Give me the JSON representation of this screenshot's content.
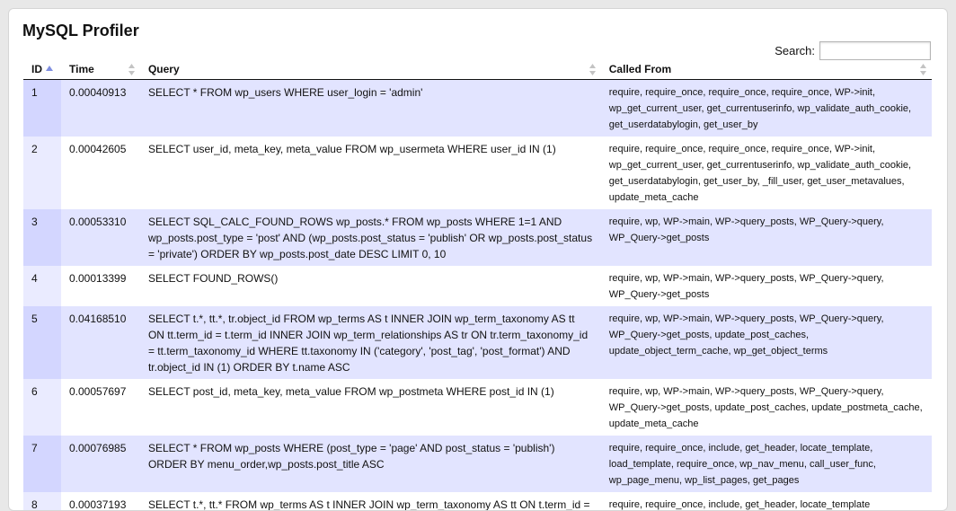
{
  "title": "MySQL Profiler",
  "search": {
    "label": "Search:",
    "value": "",
    "placeholder": ""
  },
  "columns": [
    "ID",
    "Time",
    "Query",
    "Called From"
  ],
  "sort": {
    "column": "ID",
    "direction": "ascending"
  },
  "colors": {
    "odd_row": "#e2e4ff",
    "odd_sorted_col": "#d3d6ff",
    "even_sorted_col": "#eaebff",
    "sort_arrow": "#7f8ee0"
  },
  "rows": [
    {
      "id": "1",
      "time": "0.00040913",
      "query": "SELECT * FROM wp_users WHERE user_login = 'admin'",
      "called_from": "require, require_once, require_once, require_once, WP->init, wp_get_current_user, get_currentuserinfo, wp_validate_auth_cookie, get_userdatabylogin, get_user_by"
    },
    {
      "id": "2",
      "time": "0.00042605",
      "query": "SELECT user_id, meta_key, meta_value FROM wp_usermeta WHERE user_id IN (1)",
      "called_from": "require, require_once, require_once, require_once, WP->init, wp_get_current_user, get_currentuserinfo, wp_validate_auth_cookie, get_userdatabylogin, get_user_by, _fill_user, get_user_metavalues, update_meta_cache"
    },
    {
      "id": "3",
      "time": "0.00053310",
      "query": "SELECT SQL_CALC_FOUND_ROWS wp_posts.* FROM wp_posts WHERE 1=1 AND wp_posts.post_type = 'post' AND (wp_posts.post_status = 'publish' OR wp_posts.post_status = 'private') ORDER BY wp_posts.post_date DESC LIMIT 0, 10",
      "called_from": "require, wp, WP->main, WP->query_posts, WP_Query->query, WP_Query->get_posts"
    },
    {
      "id": "4",
      "time": "0.00013399",
      "query": "SELECT FOUND_ROWS()",
      "called_from": "require, wp, WP->main, WP->query_posts, WP_Query->query, WP_Query->get_posts"
    },
    {
      "id": "5",
      "time": "0.04168510",
      "query": "SELECT t.*, tt.*, tr.object_id FROM wp_terms AS t INNER JOIN wp_term_taxonomy AS tt ON tt.term_id = t.term_id INNER JOIN wp_term_relationships AS tr ON tr.term_taxonomy_id = tt.term_taxonomy_id WHERE tt.taxonomy IN ('category', 'post_tag', 'post_format') AND tr.object_id IN (1) ORDER BY t.name ASC",
      "called_from": "require, wp, WP->main, WP->query_posts, WP_Query->query, WP_Query->get_posts, update_post_caches, update_object_term_cache, wp_get_object_terms"
    },
    {
      "id": "6",
      "time": "0.00057697",
      "query": "SELECT post_id, meta_key, meta_value FROM wp_postmeta WHERE post_id IN (1)",
      "called_from": "require, wp, WP->main, WP->query_posts, WP_Query->query, WP_Query->get_posts, update_post_caches, update_postmeta_cache, update_meta_cache"
    },
    {
      "id": "7",
      "time": "0.00076985",
      "query": "SELECT * FROM wp_posts WHERE (post_type = 'page' AND post_status = 'publish') ORDER BY menu_order,wp_posts.post_title ASC",
      "called_from": "require, require_once, include, get_header, locate_template, load_template, require_once, wp_nav_menu, call_user_func, wp_page_menu, wp_list_pages, get_pages"
    },
    {
      "id": "8",
      "time": "0.00037193",
      "query": "SELECT t.*, tt.* FROM wp_terms AS t INNER JOIN wp_term_taxonomy AS tt ON t.term_id =",
      "called_from": "require, require_once, include, get_header, locate_template"
    }
  ]
}
